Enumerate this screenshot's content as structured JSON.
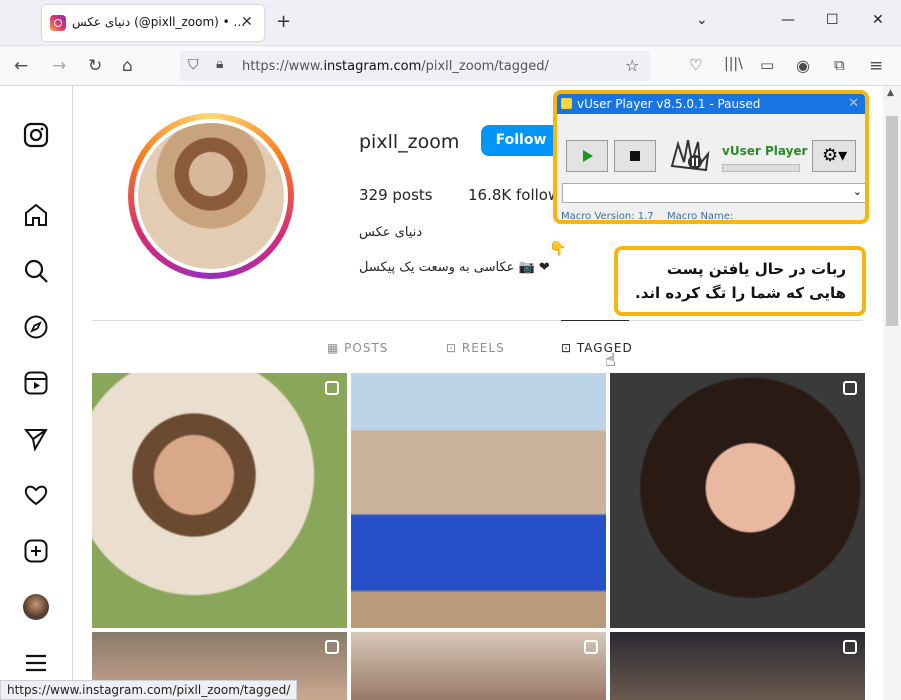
{
  "browser": {
    "tab_title": "دنیای عکس (@pixll_zoom) • ...",
    "url_prefix": "https://www.",
    "url_domain": "instagram.com",
    "url_path": "/pixll_zoom/tagged/",
    "status_url": "https://www.instagram.com/pixll_zoom/tagged/"
  },
  "profile": {
    "username": "pixll_zoom",
    "follow_label": "Follow",
    "posts": "329 posts",
    "followers": "16.8K follow",
    "full_name": "دنیای عکس",
    "bio": "عکاسی به وسعت یک پیکسل 📷 ❤",
    "tabs": [
      {
        "label": "POSTS",
        "icon": "grid-icon"
      },
      {
        "label": "REELS",
        "icon": "reels-icon"
      },
      {
        "label": "TAGGED",
        "icon": "tag-icon"
      }
    ],
    "active_tab": "TAGGED"
  },
  "vuser": {
    "title": "vUser Player v8.5.0.1 - Paused",
    "brand": "vUser Player",
    "macro_version_label": "Macro Version: 1.7",
    "macro_name_label": "Macro Name:"
  },
  "callout": {
    "line1": "ربات در حال یافتن پست",
    "line2": "هایی که شما را تگ کرده اند."
  },
  "colors": {
    "follow": "#0095f6",
    "highlight": "#f6b60e",
    "vuser_title": "#1874e0"
  }
}
